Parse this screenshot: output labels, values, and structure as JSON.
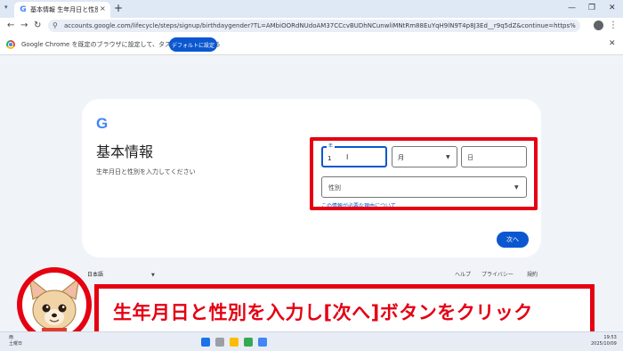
{
  "browser": {
    "tab_title": "基本情報 生年月日と性別を入力して",
    "tab_close": "×",
    "new_tab": "+",
    "url": "accounts.google.com/lifecycle/steps/signup/birthdaygender?TL=AMbiOORdNUdoAM37CCcvBUDhNCunwliMNtRm88EuYqH9lN9T4p8J3Ed__r9q5dZ&continue=https%3A%2F%2Fmail.google.com%2Fm..."
  },
  "infobar": {
    "message": "Google Chrome を既定のブラウザに設定して、タスクバーに固定する",
    "button_label": "デフォルトに設定"
  },
  "signup": {
    "logo": "G",
    "title": "基本情報",
    "subtitle": "生年月日と性別を入力してください",
    "year_label": "年",
    "year_value": "1",
    "month_value": "月",
    "day_value": "日",
    "gender_value": "性別",
    "why_info": "この情報が必要な理由について",
    "next_label": "次へ"
  },
  "footer": {
    "language": "日本語",
    "links": [
      "ヘルプ",
      "プライバシー",
      "規約"
    ]
  },
  "banner": {
    "text": "生年月日と性別を入力し[次へ]ボタンをクリック"
  },
  "taskbar": {
    "weather_line1": "雨",
    "weather_line2": "土曜日",
    "time": "19:53",
    "date": "2025/10/09"
  },
  "colors": {
    "accent": "#0b57d0",
    "highlight": "#e50012",
    "page_bg": "#f0f4f9"
  }
}
